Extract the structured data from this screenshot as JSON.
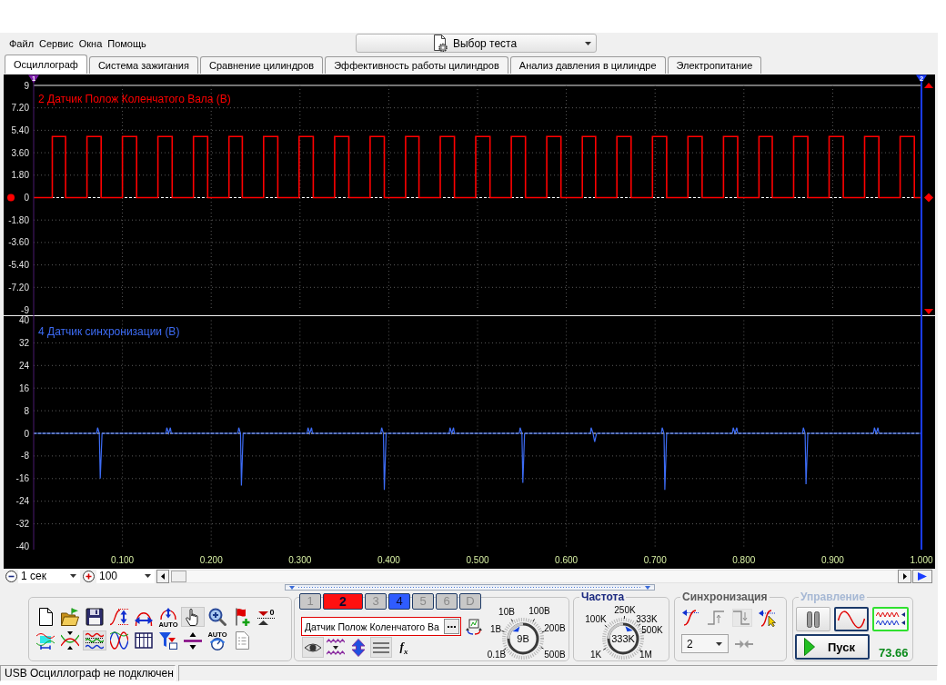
{
  "menu": [
    {
      "label": "Файл"
    },
    {
      "label": "Сервис"
    },
    {
      "label": "Окна"
    },
    {
      "label": "Помощь"
    }
  ],
  "test_picker": {
    "label": "Выбор теста"
  },
  "tabs": [
    {
      "label": "Осциллограф",
      "selected": true
    },
    {
      "label": "Система зажигания",
      "selected": false
    },
    {
      "label": "Сравнение цилиндров",
      "selected": false
    },
    {
      "label": "Эффективность работы цилиндров",
      "selected": false
    },
    {
      "label": "Анализ давления в цилиндре",
      "selected": false
    },
    {
      "label": "Электропитание",
      "selected": false
    }
  ],
  "cursors": [
    {
      "label": "1"
    },
    {
      "label": "2"
    }
  ],
  "charts": [
    {
      "chart_data": {
        "type": "line",
        "title": "2 Датчик Полож Коленчатого Вала (В)",
        "xlim": [
          0,
          1
        ],
        "ylim": [
          -9,
          9
        ],
        "yticks": [
          9,
          {
            "value": 7.2,
            "label": "7.20"
          },
          {
            "value": 5.4,
            "label": "5.40"
          },
          {
            "value": 3.6,
            "label": "3.60"
          },
          {
            "value": 1.8,
            "label": "1.80"
          },
          0,
          {
            "value": -1.8,
            "label": "-1.80"
          },
          {
            "value": -3.6,
            "label": "-3.60"
          },
          {
            "value": -5.4,
            "label": "-5.40"
          },
          {
            "value": -7.2,
            "label": "-7.20"
          },
          -9
        ],
        "grid": true,
        "ref_lines": [
          {
            "axis": "y",
            "value": 0
          }
        ],
        "x": [
          0,
          0.021,
          0.021,
          0.036,
          0.036,
          0.06,
          0.06,
          0.076,
          0.076,
          0.1,
          0.1,
          0.116,
          0.116,
          0.14,
          0.14,
          0.156,
          0.156,
          0.18,
          0.18,
          0.196,
          0.196,
          0.22,
          0.22,
          0.235,
          0.235,
          0.259,
          0.259,
          0.275,
          0.275,
          0.299,
          0.299,
          0.315,
          0.315,
          0.339,
          0.339,
          0.355,
          0.355,
          0.379,
          0.379,
          0.395,
          0.395,
          0.419,
          0.419,
          0.434,
          0.434,
          0.458,
          0.458,
          0.474,
          0.474,
          0.498,
          0.498,
          0.514,
          0.514,
          0.538,
          0.538,
          0.554,
          0.554,
          0.578,
          0.578,
          0.594,
          0.594,
          0.618,
          0.618,
          0.633,
          0.633,
          0.657,
          0.657,
          0.673,
          0.673,
          0.697,
          0.697,
          0.713,
          0.713,
          0.737,
          0.737,
          0.753,
          0.753,
          0.777,
          0.777,
          0.793,
          0.793,
          0.817,
          0.817,
          0.832,
          0.832,
          0.856,
          0.856,
          0.872,
          0.872,
          0.896,
          0.896,
          0.912,
          0.912,
          0.936,
          0.936,
          0.952,
          0.952,
          0.976,
          0.976,
          0.992,
          0.992,
          1
        ],
        "series": [
          {
            "color": "#ff0000",
            "values": [
              0,
              0,
              4.9,
              4.9,
              0,
              0,
              4.9,
              4.9,
              0,
              0,
              4.9,
              4.9,
              0,
              0,
              4.9,
              4.9,
              0,
              0,
              4.9,
              4.9,
              0,
              0,
              4.9,
              4.9,
              0,
              0,
              4.9,
              4.9,
              0,
              0,
              4.9,
              4.9,
              0,
              0,
              4.9,
              4.9,
              0,
              0,
              4.9,
              4.9,
              0,
              0,
              4.9,
              4.9,
              0,
              0,
              4.9,
              4.9,
              0,
              0,
              4.9,
              4.9,
              0,
              0,
              4.9,
              4.9,
              0,
              0,
              4.9,
              4.9,
              0,
              0,
              4.9,
              4.9,
              0,
              0,
              4.9,
              4.9,
              0,
              0,
              4.9,
              4.9,
              0,
              0,
              4.9,
              4.9,
              0,
              0,
              4.9,
              4.9,
              0,
              0,
              4.9,
              4.9,
              0,
              0,
              4.9,
              4.9,
              0,
              0,
              4.9,
              4.9,
              0,
              0,
              4.9,
              4.9,
              0,
              0,
              4.9,
              4.9,
              0,
              0
            ]
          }
        ]
      }
    },
    {
      "chart_data": {
        "type": "line",
        "title": "4 Датчик синхронизации (В)",
        "xlim": [
          0,
          1
        ],
        "ylim": [
          -40,
          40
        ],
        "yticks": [
          40,
          32,
          24,
          16,
          8,
          0,
          -8,
          -16,
          -24,
          -32,
          -40
        ],
        "xticks": [
          {
            "value": 0.1,
            "label": "0.100"
          },
          {
            "value": 0.2,
            "label": "0.200"
          },
          {
            "value": 0.3,
            "label": "0.300"
          },
          {
            "value": 0.4,
            "label": "0.400"
          },
          {
            "value": 0.5,
            "label": "0.500"
          },
          {
            "value": 0.6,
            "label": "0.600"
          },
          {
            "value": 0.7,
            "label": "0.700"
          },
          {
            "value": 0.8,
            "label": "0.800"
          },
          {
            "value": 0.9,
            "label": "0.900"
          },
          {
            "value": 1,
            "label": "1.000"
          }
        ],
        "grid": true,
        "ref_lines": [
          {
            "axis": "y",
            "value": 0
          }
        ],
        "x": [
          0,
          0.071,
          0.072,
          0.074,
          0.075,
          0.077,
          0.149,
          0.15,
          0.152,
          0.154,
          0.155,
          0.23,
          0.231,
          0.233,
          0.234,
          0.236,
          0.308,
          0.309,
          0.311,
          0.313,
          0.314,
          0.391,
          0.392,
          0.394,
          0.395,
          0.397,
          0.468,
          0.469,
          0.471,
          0.473,
          0.474,
          0.547,
          0.548,
          0.55,
          0.551,
          0.553,
          0.627,
          0.628,
          0.63,
          0.632,
          0.634,
          0.707,
          0.708,
          0.71,
          0.711,
          0.713,
          0.787,
          0.788,
          0.79,
          0.792,
          0.793,
          0.866,
          0.867,
          0.869,
          0.87,
          0.872,
          0.946,
          0.947,
          0.949,
          0.951,
          0.952,
          1
        ],
        "series": [
          {
            "color": "#3d6cf5",
            "values": [
              0,
              0,
              2,
              0,
              -16,
              0,
              0,
              2,
              0,
              2,
              0,
              0,
              2,
              0,
              -18.5,
              0,
              0,
              2,
              0,
              2,
              0,
              0,
              2,
              0,
              -20,
              0,
              0,
              2,
              0,
              2,
              0,
              0,
              2,
              0,
              -17.5,
              0,
              0,
              2,
              0,
              -3,
              0,
              0,
              2,
              0,
              -20,
              0,
              0,
              2,
              0,
              2,
              0,
              0,
              2,
              0,
              -18,
              0,
              0,
              2,
              0,
              2,
              0,
              0
            ]
          }
        ]
      }
    }
  ],
  "time_controls": {
    "timebase": "1 сек",
    "zoom": "100"
  },
  "toolbar": {
    "rows": [
      [
        {
          "selected": false
        },
        {
          "selected": false
        },
        {
          "selected": false
        },
        {
          "selected": false
        },
        {
          "selected": false
        },
        {
          "selected": false,
          "label": "AUTO"
        },
        {
          "selected": true
        },
        {
          "selected": false
        },
        {
          "selected": false
        },
        {
          "selected": false,
          "label": "0"
        }
      ],
      [
        {
          "selected": false
        },
        {
          "selected": false
        },
        {
          "selected": true
        },
        {
          "selected": false
        },
        {
          "selected": false
        },
        {
          "selected": false
        },
        {
          "selected": false
        },
        {
          "selected": false,
          "label": "AUTO"
        },
        {
          "selected": false
        }
      ]
    ]
  },
  "channel_panel": {
    "channels": [
      {
        "label": "1",
        "on": false,
        "selected": false,
        "color": "#c8c8c8"
      },
      {
        "label": "2",
        "on": true,
        "selected": true,
        "color": "#ff1010"
      },
      {
        "label": "3",
        "on": false,
        "selected": false,
        "color": "#c8c8c8"
      },
      {
        "label": "4",
        "on": true,
        "selected": false,
        "color": "#2f5cff"
      },
      {
        "label": "5",
        "on": false,
        "selected": false,
        "color": "#c8c8c8"
      },
      {
        "label": "6",
        "on": false,
        "selected": false,
        "color": "#c8c8c8"
      },
      {
        "label": "D",
        "on": false,
        "selected": false,
        "color": "#c8c8c8"
      }
    ],
    "signal_name": "Датчик Полож Коленчатого Ва",
    "tools": [
      {
        "selected": true
      },
      {
        "selected": false
      },
      {
        "selected": false
      },
      {
        "selected": true
      },
      {
        "selected": false,
        "label": "f$_{x}$"
      }
    ]
  },
  "voltage_dial": {
    "scale": [
      "10В",
      "100В",
      "1В",
      "200В",
      "0.1В",
      "500В"
    ],
    "value": "9В"
  },
  "frequency_dial": {
    "title": "Частота",
    "scale": [
      "100K",
      "250K",
      "333K",
      "500K",
      "1K",
      "1M"
    ],
    "value": "333K"
  },
  "sync": {
    "title": "Синхронизация",
    "modes": [
      {
        "selected": false
      },
      {
        "selected": false
      },
      {
        "selected": true
      },
      {
        "selected": false
      }
    ],
    "channel": "2"
  },
  "control": {
    "title": "Управление",
    "disabled": true,
    "view_modes": [
      {
        "selected": true
      },
      {
        "selected": false
      }
    ],
    "start_label": "Пуск",
    "reading": "73.66"
  },
  "status_bar": {
    "message": "USB Осциллограф не подключен"
  }
}
